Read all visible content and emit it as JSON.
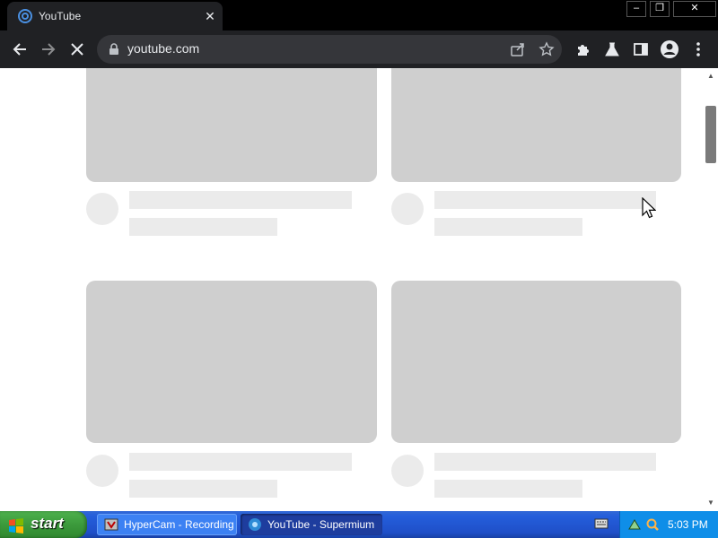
{
  "browser": {
    "tab": {
      "title": "YouTube",
      "favicon": "supermium-icon"
    },
    "address_bar": {
      "url": "youtube.com"
    },
    "colors": {
      "frame": "#202124",
      "titlebar": "#000000",
      "omnibox": "#35363a",
      "text": "#e8eaed"
    }
  },
  "page": {
    "skeleton_color_thumb": "#cfcfcf",
    "skeleton_color_line": "#ebebeb"
  },
  "taskbar": {
    "start_label": "start",
    "tasks": [
      {
        "label": "HyperCam - Recording",
        "icon": "hypercam-icon"
      },
      {
        "label": "YouTube - Supermium",
        "icon": "supermium-icon"
      }
    ],
    "clock": "5:03 PM"
  }
}
